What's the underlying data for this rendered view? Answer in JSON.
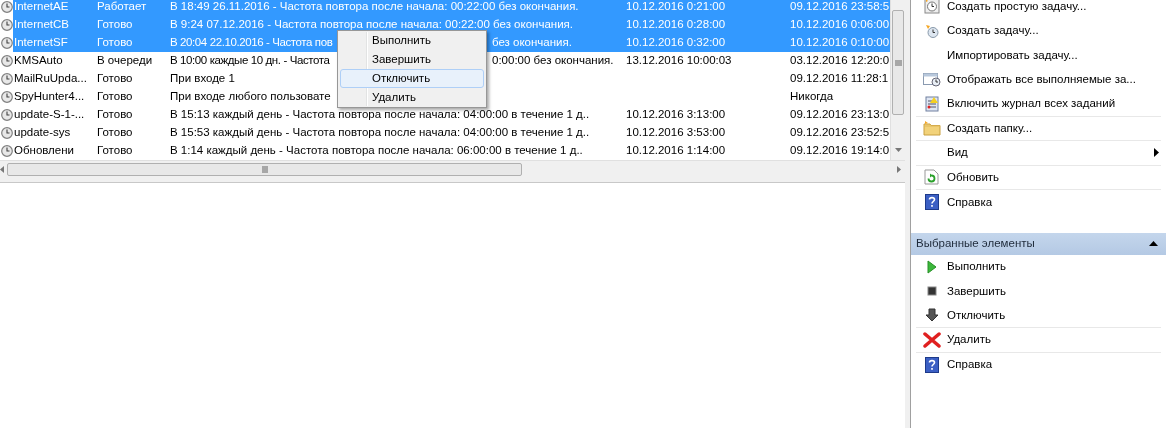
{
  "tasks": {
    "rows": [
      {
        "name": "InternetAE",
        "status": "Работает",
        "trigger": "В 18:49 26.11.2016 - Частота повтора после начала: 00:22:00 без окончания.",
        "next_run": "10.12.2016 0:21:00",
        "last_run": "09.12.2016 23:58:5",
        "selected": true
      },
      {
        "name": "InternetCB",
        "status": "Готово",
        "trigger": "В 9:24 07.12.2016 - Частота повтора после начала: 00:22:00 без окончания.",
        "next_run": "10.12.2016 0:28:00",
        "last_run": "10.12.2016 0:06:00",
        "selected": true
      },
      {
        "name": "InternetSF",
        "status": "Готово",
        "trigger": "В 20:04 22.10.2016 - Частота пов",
        "trigger_tail": "без окончания.",
        "next_run": "10.12.2016 0:32:00",
        "last_run": "10.12.2016 0:10:00",
        "selected": true
      },
      {
        "name": "KMSAuto",
        "status": "В очереди",
        "trigger": "В 10:00 каждые 10 дн. - Частота",
        "trigger_tail": "0:00:00 без окончания.",
        "next_run": "13.12.2016 10:00:03",
        "last_run": "03.12.2016 12:20:0",
        "selected": false
      },
      {
        "name": "MailRuUpda...",
        "status": "Готово",
        "trigger": "При входе 1",
        "last_run": "09.12.2016 11:28:1",
        "selected": false
      },
      {
        "name": "SpyHunter4...",
        "status": "Готово",
        "trigger": "При входе любого пользовате",
        "last_run": "Никогда",
        "selected": false
      },
      {
        "name": "update-S-1-...",
        "status": "Готово",
        "trigger": "В 15:13 каждый день - Частота повтора после начала: 04:00:00 в течение 1 д..",
        "next_run": "10.12.2016 3:13:00",
        "last_run": "09.12.2016 23:13:0",
        "selected": false
      },
      {
        "name": "update-sys",
        "status": "Готово",
        "trigger": "В 15:53 каждый день - Частота повтора после начала: 04:00:00 в течение 1 д..",
        "next_run": "10.12.2016 3:53:00",
        "last_run": "09.12.2016 23:52:5",
        "selected": false
      },
      {
        "name": "Обновлени",
        "status": "Готово",
        "trigger": "В 1:14 каждый день - Частота повтора после начала: 06:00:00 в течение 1 д..",
        "next_run": "10.12.2016 1:14:00",
        "last_run": "09.12.2016 19:14:0",
        "selected": false
      }
    ]
  },
  "context_menu": {
    "items": [
      {
        "label": "Выполнить",
        "selected": false
      },
      {
        "label": "Завершить",
        "selected": false
      },
      {
        "label": "Отключить",
        "selected": true
      },
      {
        "label": "Удалить",
        "selected": false
      }
    ]
  },
  "actions": {
    "items": [
      {
        "label": "Создать простую задачу...",
        "submenu": false,
        "divider_after": false
      },
      {
        "label": "Создать задачу...",
        "submenu": false,
        "divider_after": false
      },
      {
        "label": "Импортировать задачу...",
        "submenu": false,
        "divider_after": false
      },
      {
        "label": "Отображать все выполняемые за...",
        "submenu": false,
        "divider_after": false
      },
      {
        "label": "Включить журнал всех заданий",
        "submenu": false,
        "divider_after": true
      },
      {
        "label": "Создать папку...",
        "submenu": false,
        "divider_after": true
      },
      {
        "label": "Вид",
        "submenu": true,
        "divider_after": true
      },
      {
        "label": "Обновить",
        "submenu": false,
        "divider_after": true
      },
      {
        "label": "Справка",
        "submenu": false,
        "divider_after": false
      }
    ]
  },
  "selected_section": {
    "title": "Выбранные элементы",
    "expanded": true,
    "items": [
      {
        "label": "Выполнить",
        "divider_after": false
      },
      {
        "label": "Завершить",
        "divider_after": false
      },
      {
        "label": "Отключить",
        "divider_after": true
      },
      {
        "label": "Удалить",
        "divider_after": true
      },
      {
        "label": "Справка",
        "divider_after": false
      }
    ]
  }
}
